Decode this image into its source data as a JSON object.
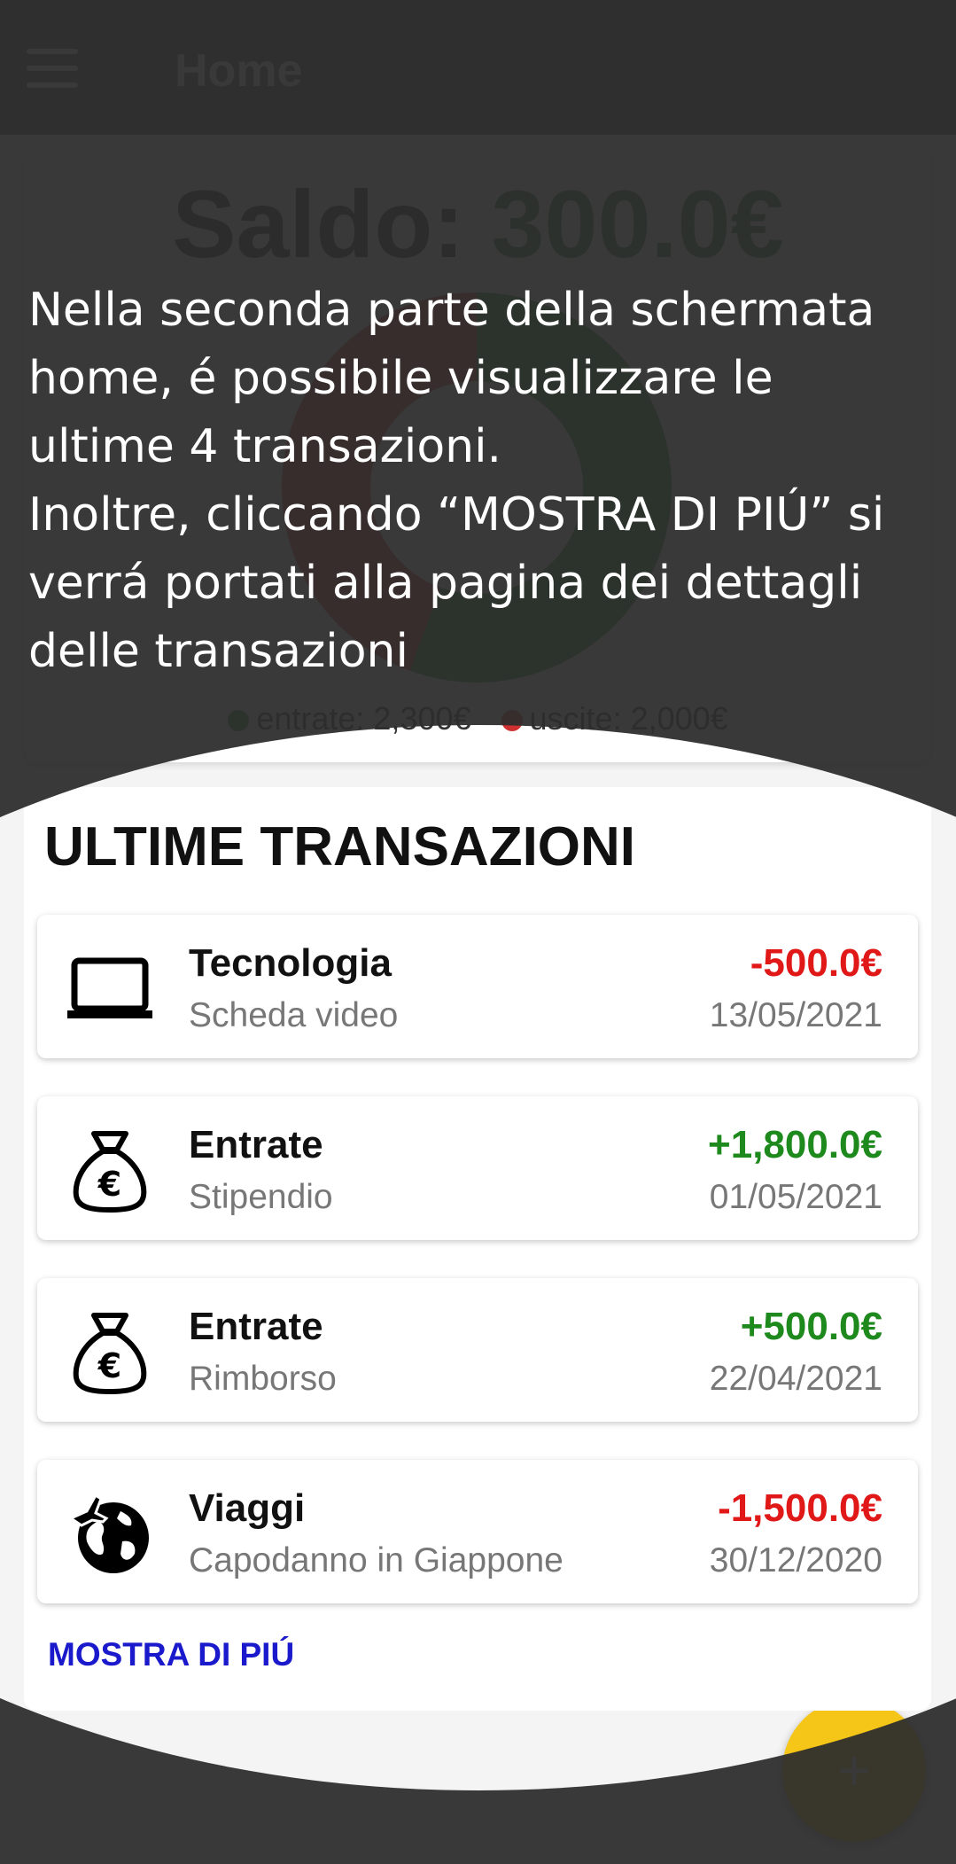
{
  "app_bar": {
    "title": "Home"
  },
  "balance": {
    "label": "Saldo:",
    "amount": "300.0€"
  },
  "legend": {
    "income": "entrate: 2,300€",
    "expenses": "uscite: 2,000€"
  },
  "tutorial": {
    "text": "Nella seconda parte della schermata\nhome, é possibile visualizzare le\nultime 4 transazioni.\nInoltre, cliccando “MOSTRA DI PIÚ” si\nverrá portati alla pagina dei dettagli\ndelle transazioni"
  },
  "transactions": {
    "title": "ULTIME TRANSAZIONI",
    "items": [
      {
        "category": "Tecnologia",
        "description": "Scheda video",
        "amount": "-500.0€",
        "date": "13/05/2021",
        "icon": "laptop-icon",
        "type": "expense"
      },
      {
        "category": "Entrate",
        "description": "Stipendio",
        "amount": "+1,800.0€",
        "date": "01/05/2021",
        "icon": "money-bag-euro-icon",
        "type": "income"
      },
      {
        "category": "Entrate",
        "description": "Rimborso",
        "amount": "+500.0€",
        "date": "22/04/2021",
        "icon": "money-bag-euro-icon",
        "type": "income"
      },
      {
        "category": "Viaggi",
        "description": "Capodanno in Giappone",
        "amount": "-1,500.0€",
        "date": "30/12/2020",
        "icon": "travel-globe-icon",
        "type": "expense"
      }
    ],
    "show_more": "MOSTRA DI PIÚ"
  },
  "fab": {
    "icon": "plus-icon",
    "label": "+"
  },
  "colors": {
    "income": "#1e8a1e",
    "expense": "#e01818",
    "link": "#1a1acc",
    "fab": "#f5c518",
    "app_bar": "#5b5e5b"
  }
}
